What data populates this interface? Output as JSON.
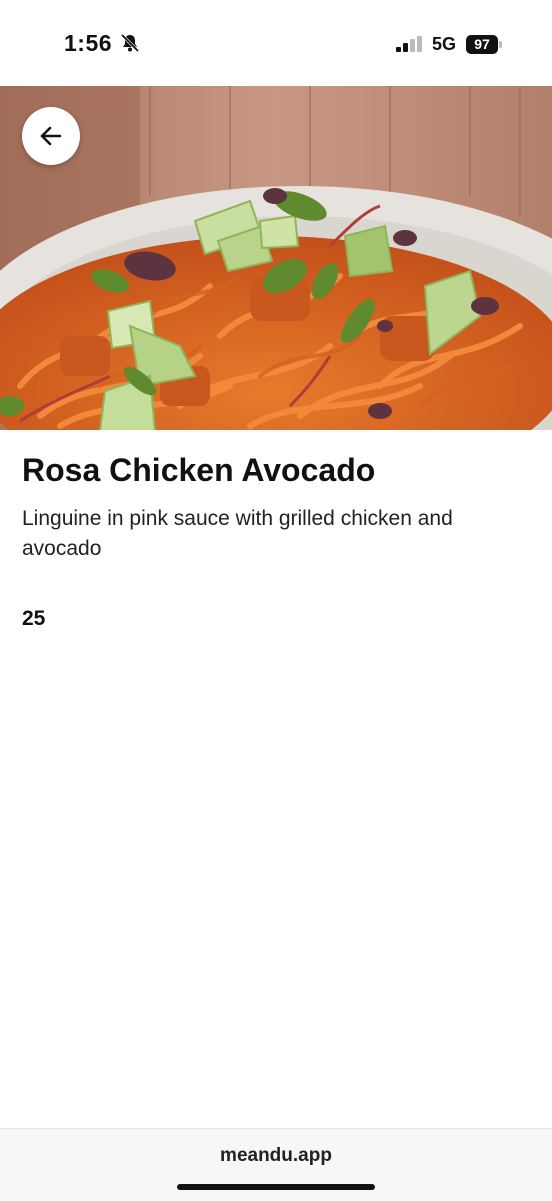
{
  "status_bar": {
    "time": "1:56",
    "network": "5G",
    "battery": "97",
    "icons": [
      "bell-slash-icon",
      "signal-icon",
      "battery-icon"
    ]
  },
  "nav": {
    "back_icon": "arrow-left-icon"
  },
  "item": {
    "name": "Rosa Chicken Avocado",
    "description": "Linguine in pink sauce with grilled chicken and avocado",
    "price": "25"
  },
  "browser": {
    "url": "meandu.app"
  },
  "colors": {
    "text": "#111111",
    "background": "#ffffff",
    "url_bar": "#f7f7f7"
  }
}
